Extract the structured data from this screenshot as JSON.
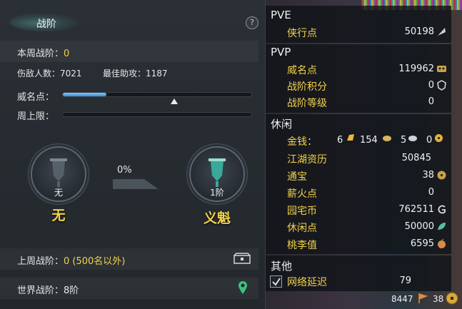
{
  "left_panel": {
    "title": "战阶",
    "help_icon": "?",
    "weekly_rank_label": "本周战阶：",
    "weekly_rank_value": "0",
    "enemies_label": "伤敌人数：",
    "enemies_value": "7021",
    "best_assist_label": "最佳助攻：",
    "best_assist_value": "1187",
    "prestige_label": "威名点：",
    "prestige_progress": 0.23,
    "prestige_marker": 0.59,
    "weekly_cap_label": "周上限：",
    "weekly_cap_progress": 0,
    "current_emblem": {
      "level": "无",
      "name": "无"
    },
    "progress_percent": "0%",
    "next_emblem": {
      "level": "1阶",
      "name": "义魁"
    },
    "last_week_label": "上周战阶：",
    "last_week_value": "0 (500名以外)",
    "world_rank_label": "世界战阶：",
    "world_rank_value": "8阶"
  },
  "right_panel": {
    "pve": {
      "title": "PVE",
      "items": [
        {
          "label": "侠行点",
          "value": "50198",
          "icon": "feather-icon"
        }
      ]
    },
    "pvp": {
      "title": "PVP",
      "items": [
        {
          "label": "威名点",
          "value": "119962",
          "icon": "mask-icon"
        },
        {
          "label": "战阶积分",
          "value": "0",
          "icon": "crest-icon"
        },
        {
          "label": "战阶等级",
          "value": "0",
          "icon": ""
        }
      ]
    },
    "leisure": {
      "title": "休闲",
      "money_label": "金钱：",
      "money_gold": "6",
      "money_silver": "154",
      "money_copper": "5",
      "money_extra": "0",
      "items": [
        {
          "label": "江湖资历",
          "value": "50845",
          "icon": ""
        },
        {
          "label": "通宝",
          "value": "38",
          "icon": "coin-icon"
        },
        {
          "label": "薪火点",
          "value": "0",
          "icon": ""
        },
        {
          "label": "园宅币",
          "value": "762511",
          "icon": "garden-coin-icon"
        },
        {
          "label": "休闲点",
          "value": "50000",
          "icon": "leaf-icon"
        },
        {
          "label": "桃李值",
          "value": "6595",
          "icon": "peach-icon"
        }
      ]
    },
    "other": {
      "title": "其他",
      "network_label": "网络延迟",
      "network_value": "79"
    },
    "bottom_status": {
      "value": "8447",
      "coins": "38"
    }
  },
  "colors": {
    "accent_yellow": "#f3d24a",
    "progress_blue": "#3f8ed4",
    "panel_bg": "#262b30"
  }
}
